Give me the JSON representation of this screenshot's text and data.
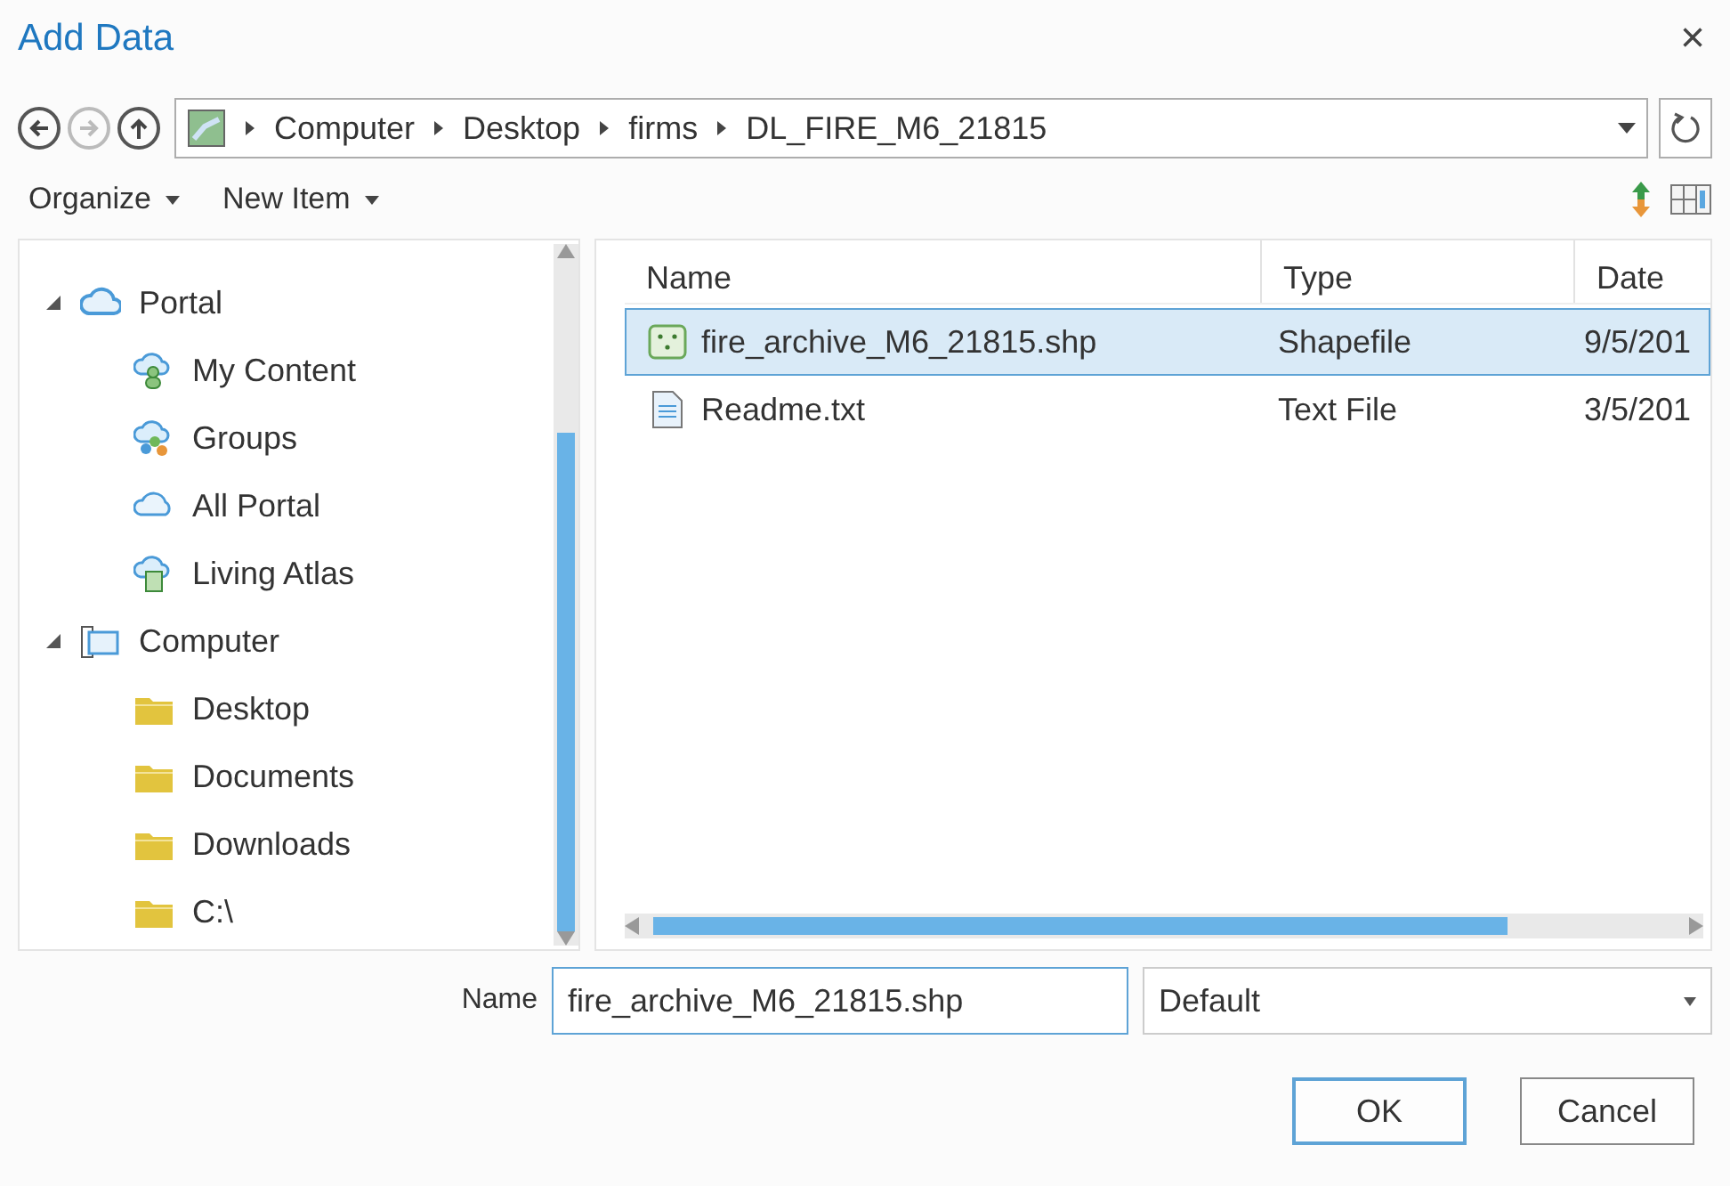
{
  "window": {
    "title": "Add Data",
    "close": "×"
  },
  "breadcrumb": [
    "Computer",
    "Desktop",
    "firms",
    "DL_FIRE_M6_21815"
  ],
  "toolbar": [
    {
      "label": "Organize"
    },
    {
      "label": "New Item"
    }
  ],
  "tree": [
    {
      "label": "Portal",
      "kind": "portal",
      "expanded": true,
      "children": [
        {
          "label": "My Content",
          "kind": "content"
        },
        {
          "label": "Groups",
          "kind": "groups"
        },
        {
          "label": "All Portal",
          "kind": "cloud"
        },
        {
          "label": "Living Atlas",
          "kind": "atlas"
        }
      ]
    },
    {
      "label": "Computer",
      "kind": "computer",
      "expanded": true,
      "children": [
        {
          "label": "Desktop",
          "kind": "folder"
        },
        {
          "label": "Documents",
          "kind": "folder"
        },
        {
          "label": "Downloads",
          "kind": "folder"
        },
        {
          "label": "C:\\",
          "kind": "folder"
        }
      ]
    }
  ],
  "table": {
    "columns": [
      "Name",
      "Type",
      "Date"
    ],
    "rows": [
      {
        "name": "fire_archive_M6_21815.shp",
        "type": "Shapefile",
        "date": "9/5/201",
        "kind": "shapefile",
        "selected": true
      },
      {
        "name": "Readme.txt",
        "type": "Text File",
        "date": "3/5/201",
        "kind": "text",
        "selected": false
      }
    ]
  },
  "name_field": {
    "label": "Name",
    "value": "fire_archive_M6_21815.shp"
  },
  "filter": {
    "value": "Default"
  },
  "buttons": [
    {
      "label": "OK",
      "default": true
    },
    {
      "label": "Cancel",
      "default": false
    }
  ]
}
